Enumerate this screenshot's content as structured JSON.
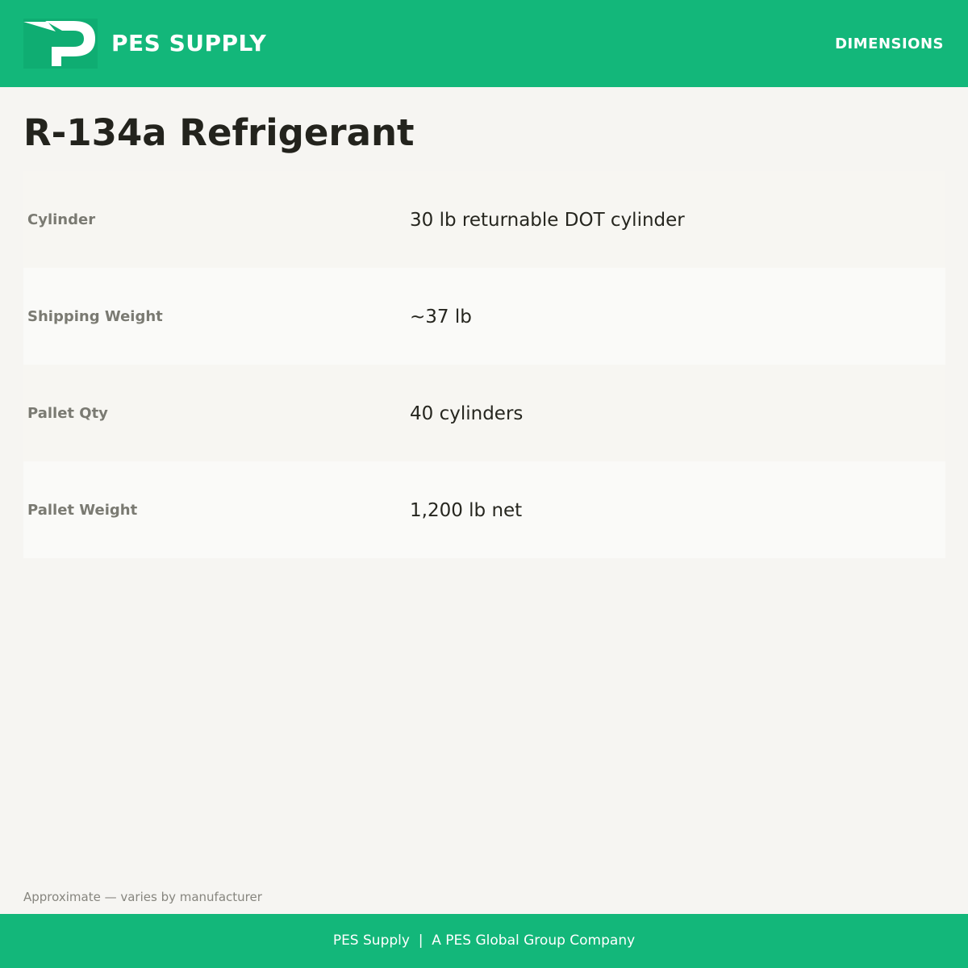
{
  "header": {
    "logo_icon": "pes-p-logo-icon",
    "brand_name": "PES SUPPLY",
    "nav_label": "DIMENSIONS"
  },
  "product": {
    "title": "R-134a Refrigerant"
  },
  "specs": [
    {
      "label": "Cylinder",
      "value": "30 lb returnable DOT cylinder"
    },
    {
      "label": "Shipping Weight",
      "value": "~37 lb"
    },
    {
      "label": "Pallet Qty",
      "value": "40 cylinders"
    },
    {
      "label": "Pallet Weight",
      "value": "1,200 lb net"
    }
  ],
  "note": "Approximate — varies by manufacturer",
  "footer": {
    "text": "PES Supply  |  A PES Global Group Company"
  },
  "colors": {
    "brand_green": "#13b77a",
    "page_background": "#f6f5f2",
    "title_text": "#23231d",
    "label_text": "#7a7a72"
  }
}
